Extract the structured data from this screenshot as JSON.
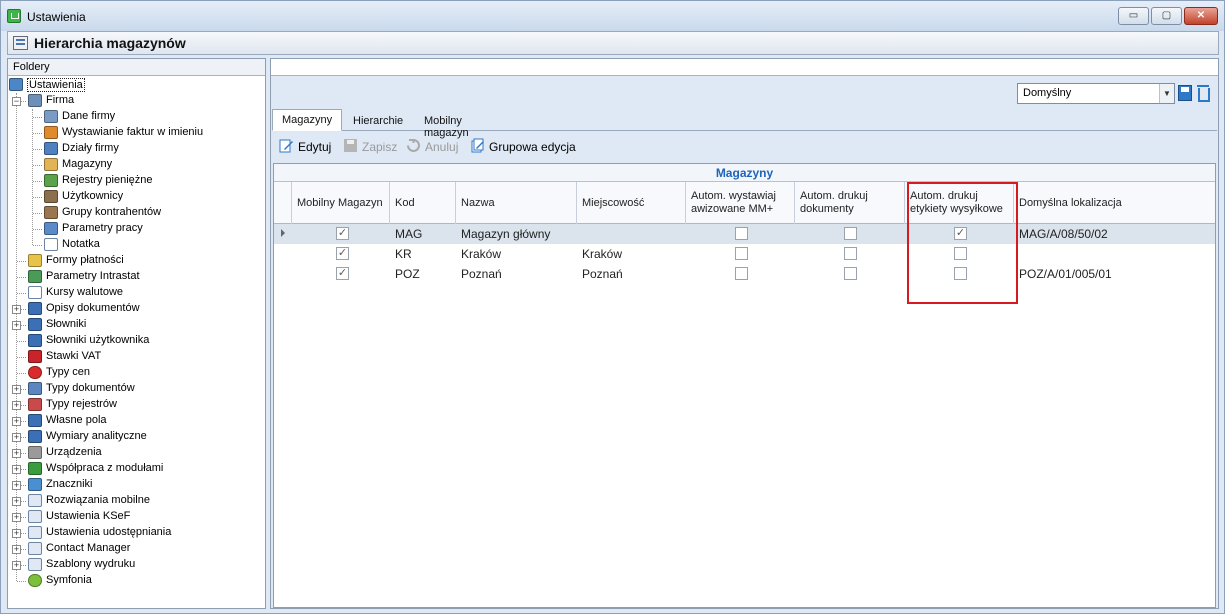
{
  "window": {
    "title": "Ustawienia",
    "buttons": {
      "minimize": "▭",
      "maximize": "▢",
      "close": "✕"
    }
  },
  "header": {
    "title": "Hierarchia magazynów"
  },
  "left_panel": {
    "label": "Foldery",
    "tree": [
      {
        "label": "Ustawienia",
        "icon": "tools-icon",
        "level": 0,
        "selected": true
      },
      {
        "label": "Firma",
        "icon": "company-icon",
        "level": 1,
        "expander": "−"
      },
      {
        "label": "Dane firmy",
        "icon": "company-data-icon",
        "level": 2
      },
      {
        "label": "Wystawianie faktur w imieniu",
        "icon": "person-icon",
        "level": 2
      },
      {
        "label": "Działy firmy",
        "icon": "departments-icon",
        "level": 2
      },
      {
        "label": "Magazyny",
        "icon": "warehouse-icon",
        "level": 2
      },
      {
        "label": "Rejestry pieniężne",
        "icon": "money-icon",
        "level": 2
      },
      {
        "label": "Użytkownicy",
        "icon": "users-icon",
        "level": 2
      },
      {
        "label": "Grupy kontrahentów",
        "icon": "groups-icon",
        "level": 2
      },
      {
        "label": "Parametry pracy",
        "icon": "parameters-icon",
        "level": 2
      },
      {
        "label": "Notatka",
        "icon": "note-icon",
        "level": 2
      },
      {
        "label": "Formy płatności",
        "icon": "payment-icon",
        "level": 1
      },
      {
        "label": "Parametry Intrastat",
        "icon": "intrastat-icon",
        "level": 1
      },
      {
        "label": "Kursy walutowe",
        "icon": "currency-chart-icon",
        "level": 1
      },
      {
        "label": "Opisy dokumentów",
        "icon": "document-icon",
        "level": 1,
        "expander": "+"
      },
      {
        "label": "Słowniki",
        "icon": "dictionary-icon",
        "level": 1,
        "expander": "+"
      },
      {
        "label": "Słowniki użytkownika",
        "icon": "dictionary-icon",
        "level": 1
      },
      {
        "label": "Stawki VAT",
        "icon": "vat-icon",
        "level": 1
      },
      {
        "label": "Typy cen",
        "icon": "price-icon",
        "level": 1
      },
      {
        "label": "Typy dokumentów",
        "icon": "document-types-icon",
        "level": 1,
        "expander": "+"
      },
      {
        "label": "Typy rejestrów",
        "icon": "registers-icon",
        "level": 1,
        "expander": "+"
      },
      {
        "label": "Własne pola",
        "icon": "fields-icon",
        "level": 1,
        "expander": "+"
      },
      {
        "label": "Wymiary analityczne",
        "icon": "dimensions-icon",
        "level": 1,
        "expander": "+"
      },
      {
        "label": "Urządzenia",
        "icon": "printer-icon",
        "level": 1,
        "expander": "+"
      },
      {
        "label": "Współpraca z modułami",
        "icon": "modules-icon",
        "level": 1,
        "expander": "+"
      },
      {
        "label": "Znaczniki",
        "icon": "tags-icon",
        "level": 1,
        "expander": "+"
      },
      {
        "label": "Rozwiązania mobilne",
        "icon": "folder-icon",
        "level": 1,
        "expander": "+"
      },
      {
        "label": "Ustawienia KSeF",
        "icon": "folder-icon",
        "level": 1,
        "expander": "+"
      },
      {
        "label": "Ustawienia udostępniania",
        "icon": "folder-icon",
        "level": 1,
        "expander": "+"
      },
      {
        "label": "Contact Manager",
        "icon": "folder-icon",
        "level": 1,
        "expander": "+"
      },
      {
        "label": "Szablony wydruku",
        "icon": "folder-icon",
        "level": 1,
        "expander": "+"
      },
      {
        "label": "Symfonia",
        "icon": "symfonia-icon",
        "level": 1
      }
    ]
  },
  "preset": {
    "value": "Domyślny"
  },
  "tabs": [
    {
      "label": "Magazyny",
      "active": true
    },
    {
      "label": "Hierarchie",
      "active": false
    },
    {
      "label": "Mobilny magazyn",
      "active": false
    }
  ],
  "toolbar": {
    "edit": "Edytuj",
    "save": "Zapisz",
    "cancel": "Anuluj",
    "group_edit": "Grupowa edycja"
  },
  "grid": {
    "caption": "Magazyny",
    "columns": [
      "Mobilny Magazyn",
      "Kod",
      "Nazwa",
      "Miejscowość",
      "Autom. wystawiaj awizowane MM+",
      "Autom. drukuj dokumenty",
      "Autom. drukuj etykiety wysyłkowe",
      "Domyślna lokalizacja"
    ],
    "rows": [
      {
        "mobile": true,
        "code": "MAG",
        "name": "Magazyn główny",
        "city": "",
        "auto_mm": false,
        "auto_print_docs": false,
        "auto_print_labels": true,
        "default_location": "MAG/A/08/50/02",
        "current": true
      },
      {
        "mobile": true,
        "code": "KR",
        "name": "Kraków",
        "city": "Kraków",
        "auto_mm": false,
        "auto_print_docs": false,
        "auto_print_labels": false,
        "default_location": "",
        "current": false
      },
      {
        "mobile": true,
        "code": "POZ",
        "name": "Poznań",
        "city": "Poznań",
        "auto_mm": false,
        "auto_print_docs": false,
        "auto_print_labels": false,
        "default_location": "POZ/A/01/005/01",
        "current": false
      }
    ]
  },
  "colors": {
    "accent": "#1f64b8",
    "highlight": "#d71920",
    "selected_row": "#dbe3ec"
  }
}
